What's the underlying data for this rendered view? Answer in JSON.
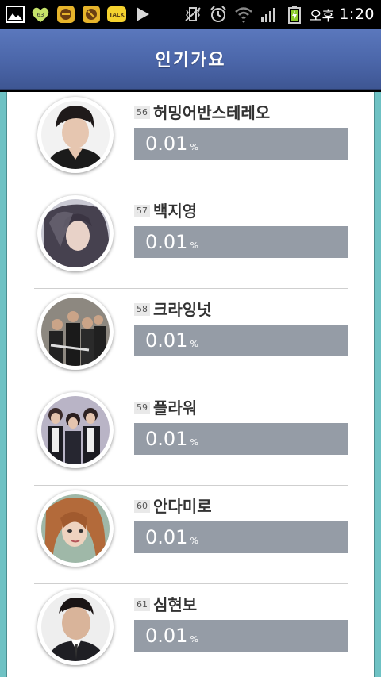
{
  "status_bar": {
    "icons_left": [
      "gallery-icon",
      "kakaotalk-green-icon",
      "app-orange-icon-1",
      "app-orange-icon-2",
      "kakaotalk-icon",
      "play-store-icon"
    ],
    "icons_right": [
      "vibrate-icon",
      "alarm-icon",
      "wifi-icon",
      "signal-icon",
      "battery-icon"
    ],
    "ampm": "오후",
    "time": "1:20"
  },
  "header": {
    "title": "인기가요"
  },
  "chart": {
    "unit": "%",
    "entries": [
      {
        "rank": "56",
        "name": "허밍어반스테레오",
        "score": "0.01"
      },
      {
        "rank": "57",
        "name": "백지영",
        "score": "0.01"
      },
      {
        "rank": "58",
        "name": "크라잉넛",
        "score": "0.01"
      },
      {
        "rank": "59",
        "name": "플라워",
        "score": "0.01"
      },
      {
        "rank": "60",
        "name": "안다미로",
        "score": "0.01"
      },
      {
        "rank": "61",
        "name": "심현보",
        "score": "0.01"
      }
    ]
  },
  "colors": {
    "header": "#4b66a9",
    "frame": "#6fc2c4",
    "score_bar": "#959ca6"
  }
}
